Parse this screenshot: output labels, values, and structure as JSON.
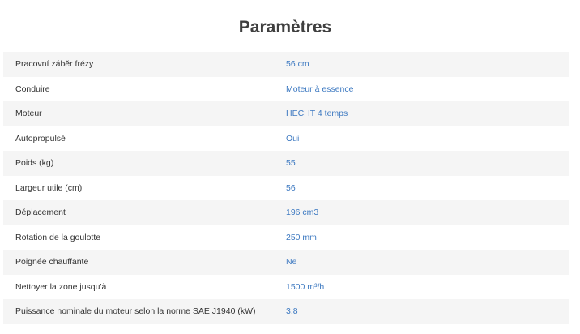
{
  "title": "Paramètres",
  "accent_color": "#3d79c1",
  "rows": [
    {
      "label": "Pracovní záběr frézy",
      "value": "56 cm"
    },
    {
      "label": "Conduire",
      "value": "Moteur à essence"
    },
    {
      "label": "Moteur",
      "value": "HECHT 4 temps"
    },
    {
      "label": "Autopropulsé",
      "value": "Oui"
    },
    {
      "label": "Poids (kg)",
      "value": "55"
    },
    {
      "label": "Largeur utile (cm)",
      "value": "56"
    },
    {
      "label": "Déplacement",
      "value": "196 cm3"
    },
    {
      "label": "Rotation de la goulotte",
      "value": "250 mm"
    },
    {
      "label": "Poignée chauffante",
      "value": "Ne"
    },
    {
      "label": "Nettoyer la zone jusqu'à",
      "value": "1500 m³/h"
    },
    {
      "label": "Puissance nominale du moteur selon la norme SAE J1940 (kW)",
      "value": "3,8"
    }
  ]
}
